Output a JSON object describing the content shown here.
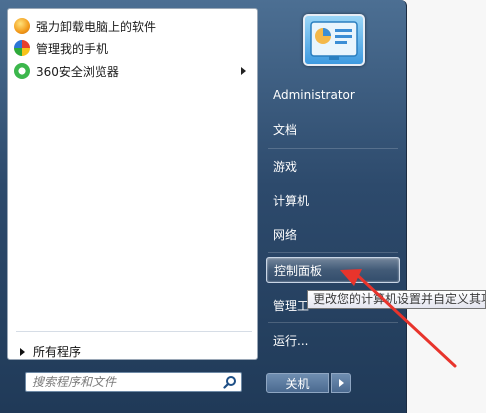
{
  "left_pane": {
    "programs": [
      {
        "label": "强力卸载电脑上的软件",
        "icon": "uninstall-icon",
        "has_submenu": false
      },
      {
        "label": "管理我的手机",
        "icon": "phone-manager-icon",
        "has_submenu": false
      },
      {
        "label": "360安全浏览器",
        "icon": "browser-360-icon",
        "has_submenu": true
      }
    ],
    "all_programs_label": "所有程序",
    "search_placeholder": "搜索程序和文件"
  },
  "right_pane": {
    "user_name": "Administrator",
    "items": {
      "documents": "文档",
      "games": "游戏",
      "computer": "计算机",
      "network": "网络",
      "control_panel": "控制面板",
      "admin_tools": "管理工",
      "run": "运行..."
    },
    "shutdown_label": "关机"
  },
  "tooltip": {
    "text": "更改您的计算机设置并自定义其功能。"
  },
  "colors": {
    "annotation_arrow": "#e8342c",
    "menu_frame": "#2d4a6c"
  }
}
